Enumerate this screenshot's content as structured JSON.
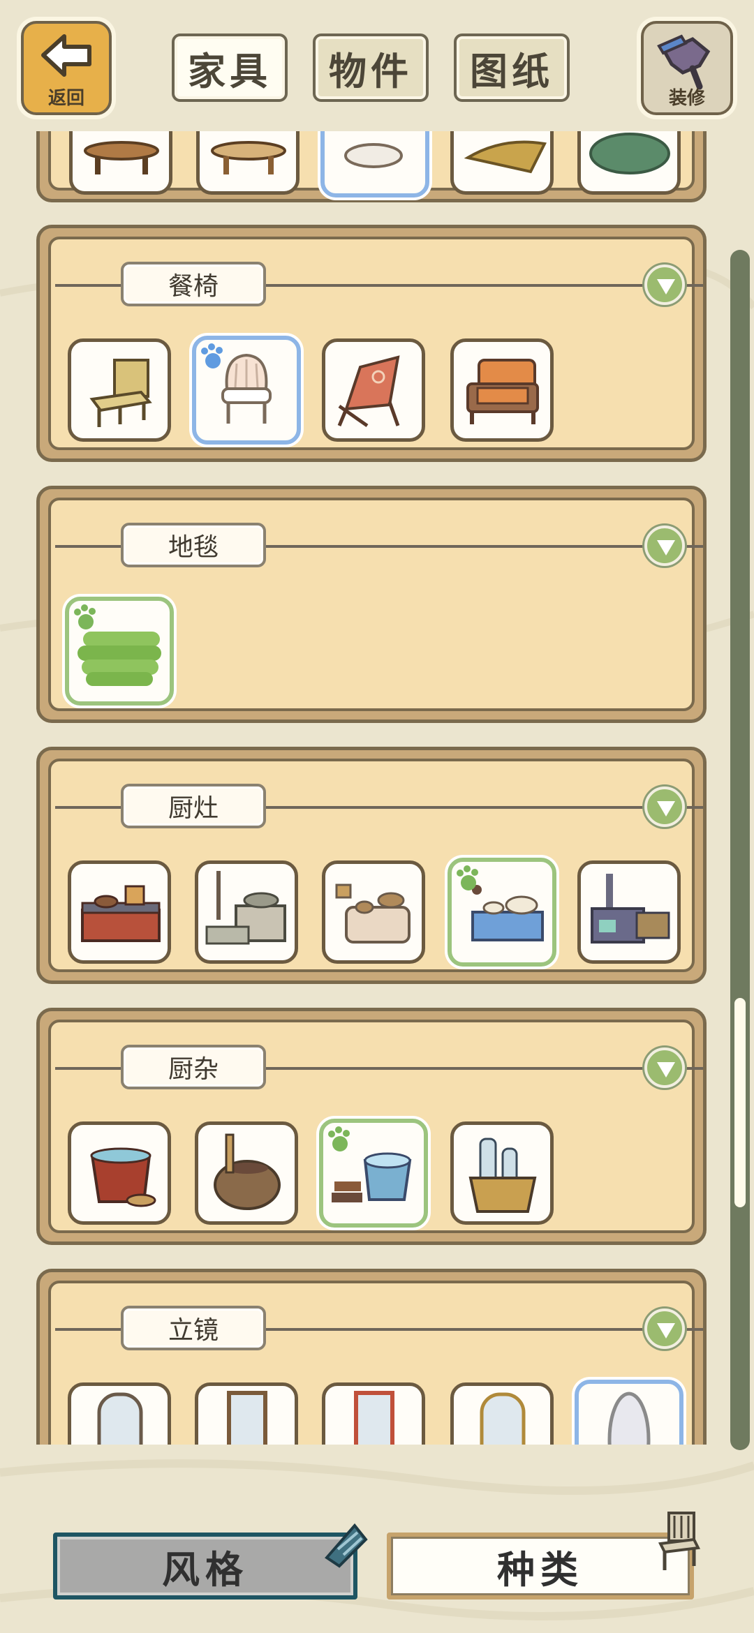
{
  "header": {
    "back_label": "返回",
    "tabs": [
      {
        "label": "家具",
        "active": true
      },
      {
        "label": "物件",
        "active": false
      },
      {
        "label": "图纸",
        "active": false
      }
    ],
    "repair_label": "装修"
  },
  "categories": [
    {
      "name": "",
      "items": [
        "table-1",
        "table-2",
        "shell-table",
        "leaf-table",
        "green-table"
      ]
    },
    {
      "name": "餐椅",
      "items": [
        "bamboo-chair",
        "shell-chair",
        "deck-chair",
        "orange-armchair"
      ]
    },
    {
      "name": "地毯",
      "items": [
        "green-rolled-rug"
      ]
    },
    {
      "name": "厨灶",
      "items": [
        "brick-stove",
        "stone-sink-stove",
        "clay-oven",
        "blue-kitchen-counter",
        "iron-wood-stove"
      ]
    },
    {
      "name": "厨杂",
      "items": [
        "red-pot",
        "clay-jar",
        "wash-tub",
        "bottle-cooler"
      ]
    },
    {
      "name": "立镜",
      "items": [
        "wood-mirror-1",
        "wood-mirror-2",
        "red-mirror",
        "gold-mirror",
        "shell-mirror"
      ]
    }
  ],
  "bottom": {
    "style_label": "风格",
    "type_label": "种类"
  },
  "colors": {
    "panel_fill": "#f6dfaf",
    "panel_border": "#7a6a4d",
    "selected_blue": "#8db5e6",
    "selected_green": "#9cc47e",
    "toggle_green": "#9bbb6f"
  }
}
